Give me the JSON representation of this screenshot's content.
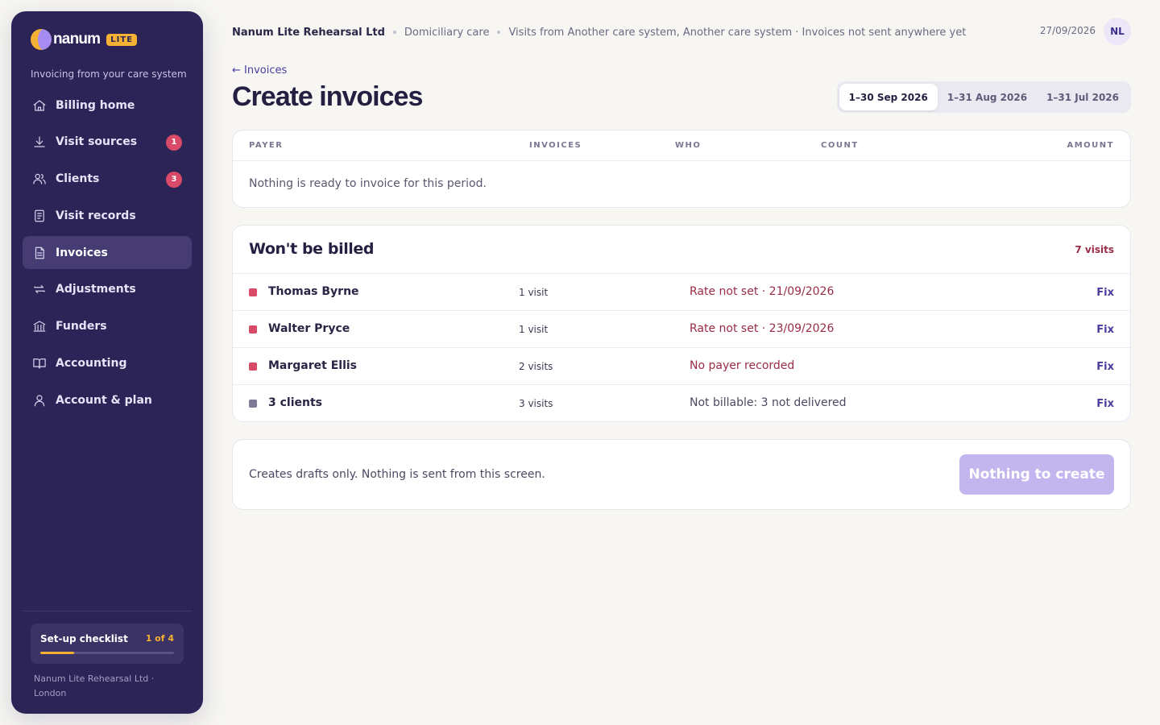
{
  "sidebar": {
    "brand_name": "nanum",
    "brand_badge": "LITE",
    "tagline": "Invoicing from your care system",
    "items": [
      {
        "label": "Billing home",
        "icon": "home-icon",
        "count": null
      },
      {
        "label": "Visit sources",
        "icon": "download-icon",
        "count": "1"
      },
      {
        "label": "Clients",
        "icon": "users-icon",
        "count": "3"
      },
      {
        "label": "Visit records",
        "icon": "document-icon",
        "count": null
      },
      {
        "label": "Invoices",
        "icon": "invoice-icon",
        "count": null,
        "active": true
      },
      {
        "label": "Adjustments",
        "icon": "arrows-icon",
        "count": null
      },
      {
        "label": "Funders",
        "icon": "bank-icon",
        "count": null
      },
      {
        "label": "Accounting",
        "icon": "book-icon",
        "count": null
      },
      {
        "label": "Account & plan",
        "icon": "user-icon",
        "count": null
      }
    ],
    "checklist": {
      "title": "Set-up checklist",
      "progress_text": "1 of 4",
      "progress_fraction": 0.25
    },
    "footer": "Nanum Lite Rehearsal Ltd · London"
  },
  "topbar": {
    "org": "Nanum Lite Rehearsal Ltd",
    "care_type": "Domiciliary care",
    "source_note": "Visits from Another care system, Another care system · Invoices not sent anywhere yet",
    "date": "27/09/2026",
    "avatar_initials": "NL"
  },
  "page": {
    "back_link": "← Invoices",
    "title": "Create invoices",
    "periods": [
      "1–30 Sep 2026",
      "1–31 Aug 2026",
      "1–31 Jul 2026"
    ],
    "active_period": 0
  },
  "invoice_table": {
    "columns": {
      "payer": "PAYER",
      "invoices": "INVOICES",
      "who": "WHO",
      "count": "COUNT",
      "amount": "AMOUNT"
    },
    "empty_message": "Nothing is ready to invoice for this period."
  },
  "unbilled": {
    "title": "Won't be billed",
    "count_label": "7 visits",
    "rows": [
      {
        "name": "Thomas Byrne",
        "visits": "1 visit",
        "reason": "Rate not set · 21/09/2026",
        "status": "error",
        "action": "Fix"
      },
      {
        "name": "Walter Pryce",
        "visits": "1 visit",
        "reason": "Rate not set · 23/09/2026",
        "status": "error",
        "action": "Fix"
      },
      {
        "name": "Margaret Ellis",
        "visits": "2 visits",
        "reason": "No payer recorded",
        "status": "error",
        "action": "Fix"
      },
      {
        "name": "3 clients",
        "visits": "3 visits",
        "reason": "Not billable: 3 not delivered",
        "status": "neutral",
        "action": "Fix"
      }
    ]
  },
  "footer_bar": {
    "note": "Creates drafts only. Nothing is sent from this screen.",
    "button_label": "Nothing to create"
  },
  "colors": {
    "sidebar_bg": "#2c2356",
    "accent": "#f5b133",
    "error": "#d94a68",
    "error_text": "#9a2c45",
    "neutral_dot": "#7f7996",
    "button_disabled": "#c3b6ef"
  }
}
